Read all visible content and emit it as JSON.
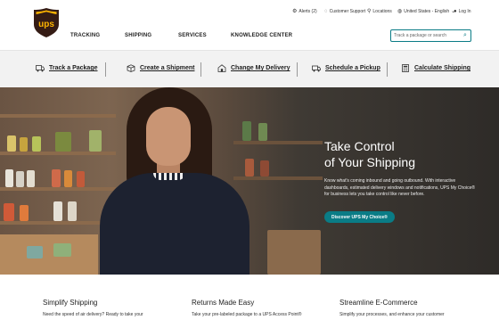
{
  "header": {
    "logo_text": "ups",
    "utility": [
      {
        "icon": "gear-icon",
        "label": "Alerts (2)"
      },
      {
        "icon": "chat-icon",
        "label": "Customer Support"
      },
      {
        "icon": "location-pin-icon",
        "label": "Locations"
      },
      {
        "icon": "globe-icon",
        "label": "United States - English"
      },
      {
        "icon": "user-icon",
        "label": "Log In"
      }
    ],
    "nav": [
      "TRACKING",
      "SHIPPING",
      "SERVICES",
      "KNOWLEDGE CENTER"
    ],
    "search_placeholder": "Track a package or search"
  },
  "quick_actions": [
    {
      "icon": "truck-box-icon",
      "label": "Track a Package"
    },
    {
      "icon": "box-icon",
      "label": "Create a Shipment"
    },
    {
      "icon": "house-icon",
      "label": "Change My Delivery"
    },
    {
      "icon": "truck-icon",
      "label": "Schedule a Pickup"
    },
    {
      "icon": "calculator-icon",
      "label": "Calculate Shipping"
    }
  ],
  "hero": {
    "title_line1": "Take Control",
    "title_line2": "of Your Shipping",
    "text": "Know what's coming inbound and going outbound. With interactive dashboards, estimated delivery windows and notifications, UPS My Choice® for business lets you take control like never before.",
    "button": "Discover UPS My Choice®"
  },
  "cards": [
    {
      "title": "Simplify Shipping",
      "text": "Need the speed of air delivery? Ready to take your"
    },
    {
      "title": "Returns Made Easy",
      "text": "Take your pre-labeled package to a UPS Access Point®"
    },
    {
      "title": "Streamline E-Commerce",
      "text": "Simplify your processes, and enhance your customer"
    }
  ],
  "colors": {
    "brand_brown": "#351c15",
    "brand_gold": "#ffb500",
    "accent_teal": "#0a7c86"
  }
}
